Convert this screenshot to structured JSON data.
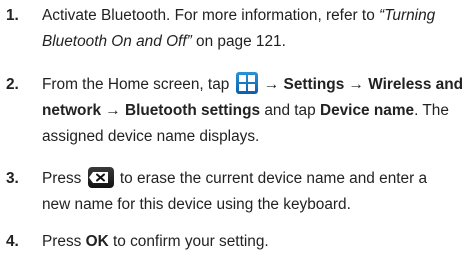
{
  "steps": [
    {
      "number": "1.",
      "line1": "Activate Bluetooth. For more information, refer to ",
      "line1_ref": "“Turning",
      "line2_ref": "Bluetooth On and Off”",
      "line2_tail": "  on page 121."
    },
    {
      "number": "2.",
      "l1_a": "From the Home screen, tap ",
      "l1_arrow1": "→ Settings → Wireless and",
      "l2_a": "network → Bluetooth settings",
      "l2_b": " and tap ",
      "l2_c": "Device name",
      "l2_d": ". The",
      "l3": "assigned device name displays."
    },
    {
      "number": "3.",
      "l1_a": "Press ",
      "l1_b": " to erase the current device name and enter a",
      "l2": "new name for this device using the keyboard."
    },
    {
      "number": "4.",
      "l1_a": "Press ",
      "l1_b": "OK",
      "l1_c": " to confirm your setting."
    }
  ],
  "icons": {
    "applications": "applications-grid-icon",
    "delete": "backspace-delete-icon"
  }
}
